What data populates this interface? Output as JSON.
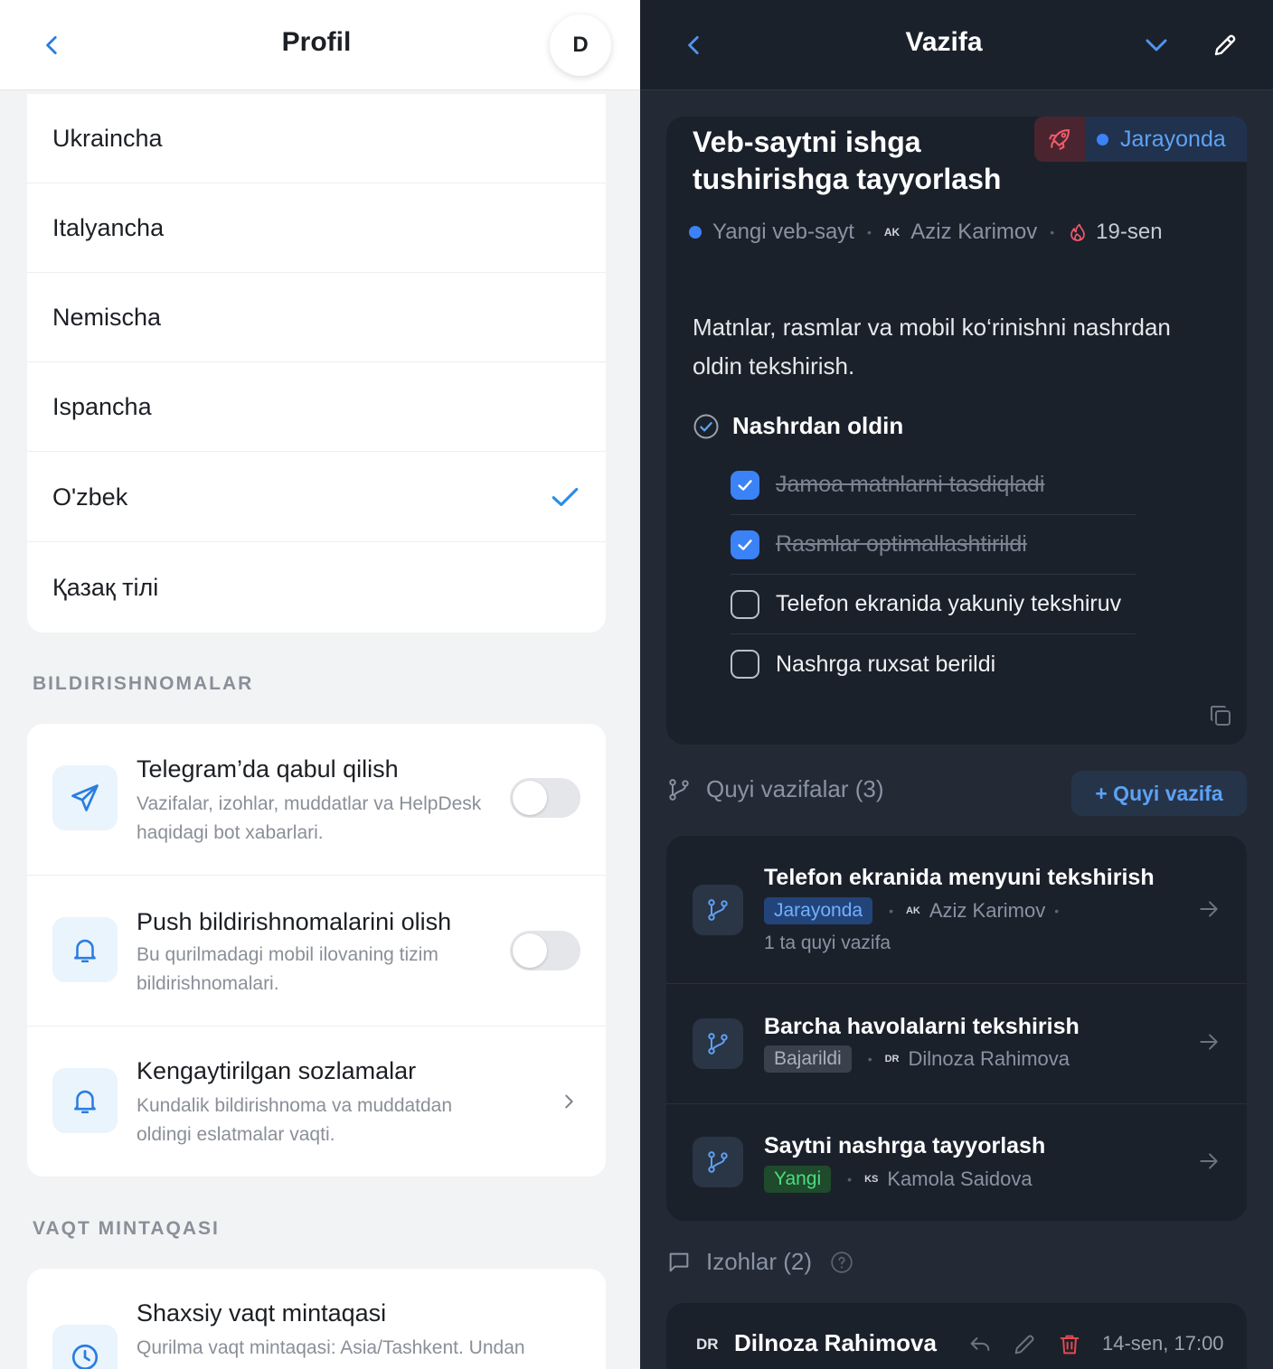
{
  "profile": {
    "title": "Profil",
    "avatar_initial": "D",
    "languages": [
      {
        "label": "Ukraincha",
        "selected": false
      },
      {
        "label": "Italyancha",
        "selected": false
      },
      {
        "label": "Nemischa",
        "selected": false
      },
      {
        "label": "Ispancha",
        "selected": false
      },
      {
        "label": "O'zbek",
        "selected": true
      },
      {
        "label": "Қазақ тілі",
        "selected": false
      }
    ],
    "notifications_section": "BILDIRISHNOMALAR",
    "notifications": [
      {
        "title": "Telegram’da qabul qilish",
        "desc": "Vazifalar, izohlar, muddatlar va HelpDesk haqidagi bot xabarlari.",
        "icon": "send-icon",
        "control": "toggle",
        "enabled": false
      },
      {
        "title": "Push bildirishnomalarini olish",
        "desc": "Bu qurilmadagi mobil ilovaning tizim bildirishnomalari.",
        "icon": "bell-icon",
        "control": "toggle",
        "enabled": false
      },
      {
        "title": "Kengaytirilgan sozlamalar",
        "desc": "Kundalik bildirishnoma va muddatdan oldingi eslatmalar vaqti.",
        "icon": "bell-icon",
        "control": "chevron"
      }
    ],
    "timezone_section": "VAQT MINTAQASI",
    "timezone": {
      "title": "Shaxsiy vaqt mintaqasi",
      "desc": "Qurilma vaqt mintaqasi: Asia/Tashkent. Undan",
      "icon": "clock-icon"
    }
  },
  "task": {
    "header_title": "Vazifa",
    "title": "Veb-saytni ishga tushirishga tayyorlash",
    "status": "Jarayonda",
    "project": "Yangi veb-sayt",
    "assignee_initials": "AK",
    "assignee": "Aziz Karimov",
    "due": "19-sen",
    "description": "Matnlar, rasmlar va mobil ko‘rinishni nashrdan oldin tekshirish.",
    "checklist": {
      "title": "Nashrdan oldin",
      "items": [
        {
          "label": "Jamoa matnlarni tasdiqladi",
          "done": true
        },
        {
          "label": "Rasmlar optimallashtirildi",
          "done": true
        },
        {
          "label": "Telefon ekranida yakuniy tekshiruv",
          "done": false
        },
        {
          "label": "Nashrga ruxsat berildi",
          "done": false
        }
      ]
    },
    "subtasks_label": "Quyi vazifalar (3)",
    "add_subtask_label": "+ Quyi vazifa",
    "subtasks": [
      {
        "title": "Telefon ekranida menyuni tekshirish",
        "status": "Jarayonda",
        "status_color": "blue",
        "initials": "AK",
        "assignee": "Aziz Karimov",
        "count": "1 ta quyi vazifa"
      },
      {
        "title": "Barcha havolalarni tekshirish",
        "status": "Bajarildi",
        "status_color": "gray",
        "initials": "DR",
        "assignee": "Dilnoza Rahimova"
      },
      {
        "title": "Saytni nashrga tayyorlash",
        "status": "Yangi",
        "status_color": "green",
        "initials": "KS",
        "assignee": "Kamola Saidova"
      }
    ],
    "comments_label": "Izohlar (2)",
    "comment": {
      "initials": "DR",
      "author": "Dilnoza Rahimova",
      "time": "14-sen, 17:00"
    }
  },
  "colors": {
    "accent": "#3b82f6",
    "left_bg": "#f2f3f5",
    "right_bg": "#232a36",
    "danger": "#ef4444"
  }
}
